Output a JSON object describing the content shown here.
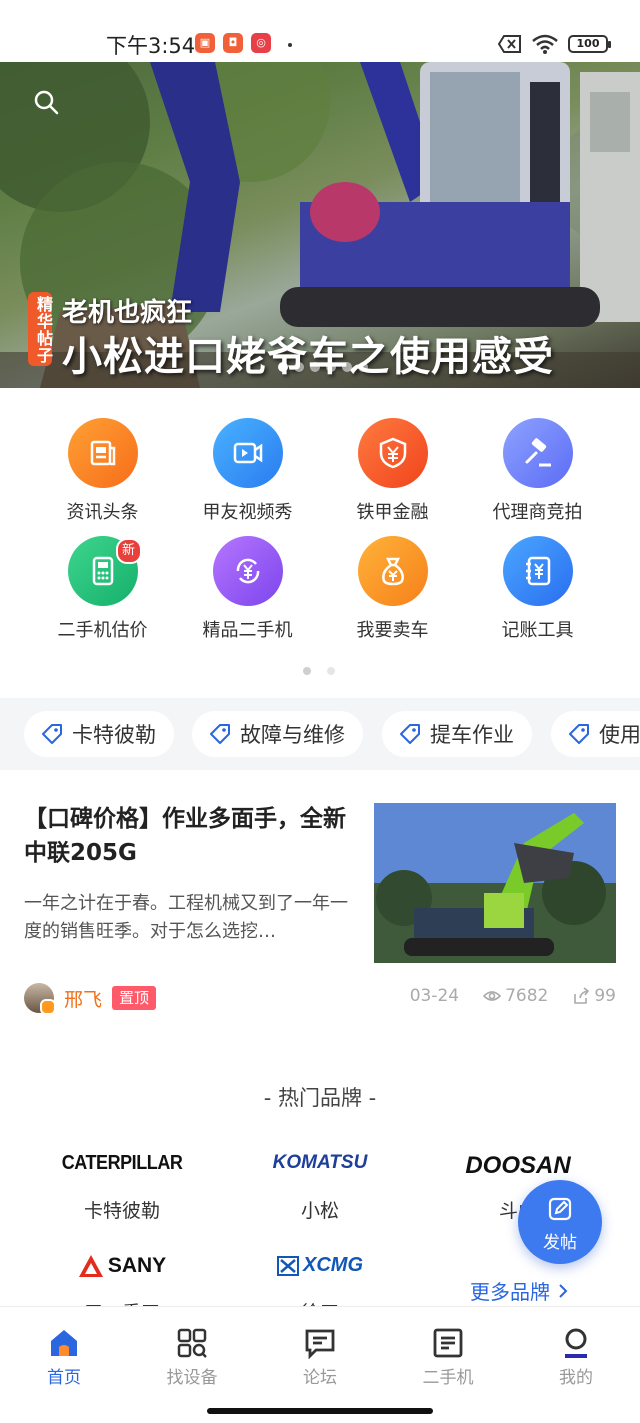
{
  "status_bar": {
    "time": "下午3:54",
    "battery": "100"
  },
  "banner": {
    "tag": "精华帖子",
    "subtitle": "老机也疯狂",
    "title": "小松进口姥爷车之使用感受",
    "slide_count": 6,
    "active_slide": 1
  },
  "grid_menu": {
    "items": [
      {
        "label": "资讯头条",
        "icon": "news-icon",
        "color": "#f7821f"
      },
      {
        "label": "甲友视频秀",
        "icon": "video-icon",
        "color": "#3a94f5"
      },
      {
        "label": "铁甲金融",
        "icon": "finance-shield-icon",
        "color": "#f25a26"
      },
      {
        "label": "代理商竞拍",
        "icon": "auction-gavel-icon",
        "color": "#6f80f7"
      },
      {
        "label": "二手机估价",
        "icon": "valuation-calculator-icon",
        "color": "#22c07a",
        "badge": "新"
      },
      {
        "label": "精品二手机",
        "icon": "yuan-cycle-icon",
        "color": "#9a5cf4"
      },
      {
        "label": "我要卖车",
        "icon": "money-bag-icon",
        "color": "#f8951f"
      },
      {
        "label": "记账工具",
        "icon": "ledger-book-icon",
        "color": "#3a8af5"
      }
    ],
    "page_count": 2,
    "active_page": 1
  },
  "tags": {
    "items": [
      "卡特彼勒",
      "故障与维修",
      "提车作业",
      "使用"
    ]
  },
  "article": {
    "title": "【口碑价格】作业多面手，全新中联205G",
    "description": "一年之计在于春。工程机械又到了一年一度的销售旺季。对于怎么选挖…",
    "author": "邢飞",
    "pin_label": "置顶",
    "date": "03-24",
    "views": "7682",
    "likes": "99"
  },
  "brands": {
    "title": "- 热门品牌 -",
    "items": [
      {
        "logo": "CATERPILLAR",
        "label": "卡特彼勒"
      },
      {
        "logo": "KOMATSU",
        "label": "小松"
      },
      {
        "logo": "DOOSAN",
        "label": "斗山"
      },
      {
        "logo": "SANY",
        "label": "三一重工"
      },
      {
        "logo": "XCMG",
        "label": "徐工"
      }
    ],
    "more_label": "更多品牌",
    "more_icon": "chevron-right-icon"
  },
  "fab": {
    "label": "发帖",
    "icon": "edit-icon"
  },
  "bottom_nav": {
    "items": [
      {
        "label": "首页",
        "icon": "home-icon",
        "active": true
      },
      {
        "label": "找设备",
        "icon": "find-equipment-icon",
        "active": false
      },
      {
        "label": "论坛",
        "icon": "forum-icon",
        "active": false
      },
      {
        "label": "二手机",
        "icon": "used-machine-icon",
        "active": false
      },
      {
        "label": "我的",
        "icon": "profile-icon",
        "active": false
      }
    ]
  },
  "colors": {
    "accent": "#2a66e0",
    "author": "#f0701a",
    "pin": "#ff5a6a"
  }
}
